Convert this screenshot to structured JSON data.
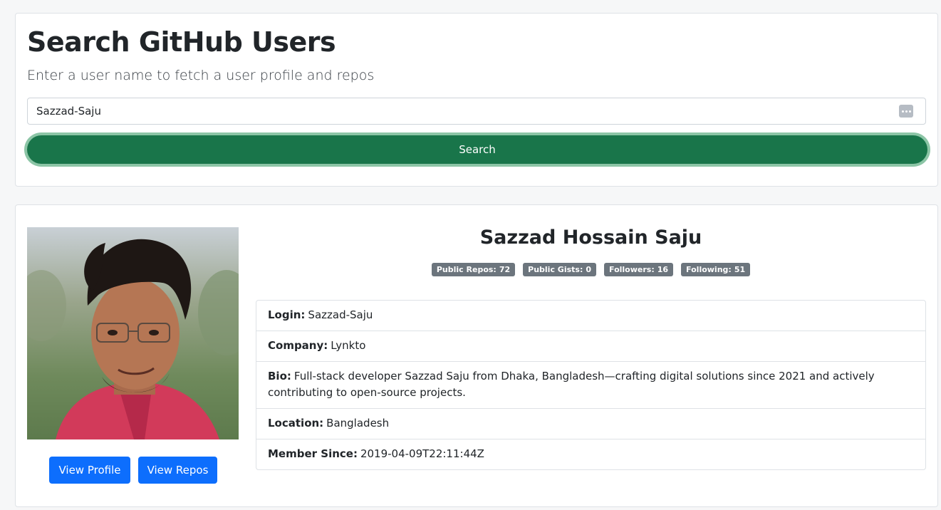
{
  "header": {
    "title": "Search GitHub Users",
    "subtitle": "Enter a user name to fetch a user profile and repos"
  },
  "search": {
    "value": "Sazzad-Saju",
    "button_label": "Search"
  },
  "profile": {
    "name": "Sazzad Hossain Saju",
    "badges": [
      {
        "label": "Public Repos:",
        "value": "72"
      },
      {
        "label": "Public Gists:",
        "value": "0"
      },
      {
        "label": "Followers:",
        "value": "16"
      },
      {
        "label": "Following:",
        "value": "51"
      }
    ],
    "info": [
      {
        "label": "Login:",
        "value": "Sazzad-Saju"
      },
      {
        "label": "Company:",
        "value": "Lynkto"
      },
      {
        "label": "Bio:",
        "value": "Full-stack developer Sazzad Saju from Dhaka, Bangladesh—crafting digital solutions since 2021 and actively contributing to open-source projects."
      },
      {
        "label": "Location:",
        "value": "Bangladesh"
      },
      {
        "label": "Member Since:",
        "value": "2019-04-09T22:11:44Z"
      }
    ],
    "view_profile_label": "View Profile",
    "view_repos_label": "View Repos"
  },
  "colors": {
    "search_button": "#19754a",
    "primary_button": "#0d6efd",
    "badge": "#6c757d"
  }
}
